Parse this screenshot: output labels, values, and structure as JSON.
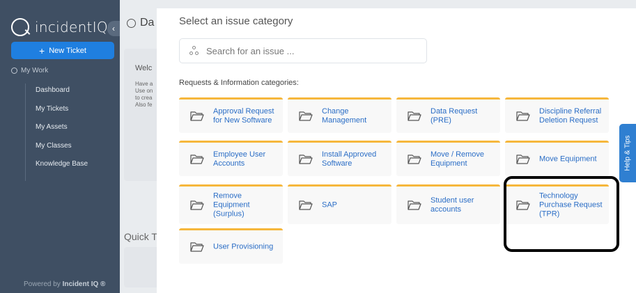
{
  "sidebar": {
    "logo_text": "incidentIQ.",
    "collapse_glyph": "‹",
    "new_ticket_label": "New Ticket",
    "section_label": "My Work",
    "items": [
      {
        "label": "Dashboard"
      },
      {
        "label": "My Tickets"
      },
      {
        "label": "My Assets"
      },
      {
        "label": "My Classes"
      },
      {
        "label": "Knowledge Base"
      }
    ],
    "powered_prefix": "Powered by",
    "powered_brand": "Incident IQ ®"
  },
  "background": {
    "title": "Da",
    "welcome_heading": "Welc",
    "welcome_text": "Have a\nUse on\nto crea\nAlso fe",
    "quick_label": "Quick T"
  },
  "modal": {
    "title": "Select an issue category",
    "search_placeholder": "Search for an issue ...",
    "section_label": "Requests & Information categories:",
    "categories": [
      {
        "label": "Approval Request for New Software"
      },
      {
        "label": "Change Management"
      },
      {
        "label": "Data Request (PRE)"
      },
      {
        "label": "Discipline Referral Deletion Request"
      },
      {
        "label": "Employee User Accounts"
      },
      {
        "label": "Install Approved Software"
      },
      {
        "label": "Move / Remove Equipment"
      },
      {
        "label": "Move Equipment"
      },
      {
        "label": "Remove Equipment (Surplus)"
      },
      {
        "label": "SAP"
      },
      {
        "label": "Student user accounts"
      },
      {
        "label": "Technology Purchase Request (TPR)"
      },
      {
        "label": "User Provisioning"
      }
    ]
  },
  "help_tab": {
    "label": "Help & Tips"
  },
  "colors": {
    "sidebar_bg": "#3f4f63",
    "accent": "#1f7fe0",
    "tile_border": "#f6b73c",
    "tile_text": "#2b6ec6",
    "highlight": "#000000"
  },
  "icons": [
    "logo-icon",
    "plus-icon",
    "user-icon",
    "dashboard-icon",
    "search-icon",
    "folder-icon"
  ]
}
